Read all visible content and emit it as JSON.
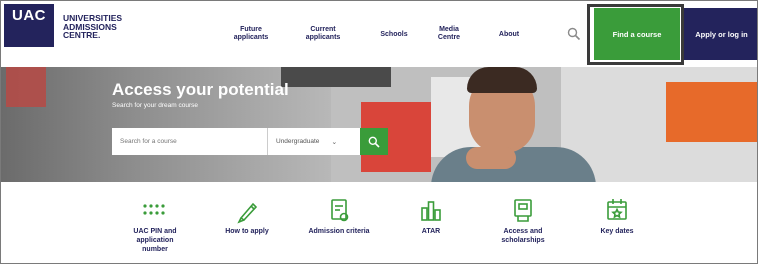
{
  "brand": {
    "logo_abbr": "UAC",
    "name_lines": [
      "UNIVERSITIES",
      "ADMISSIONS",
      "CENTRE."
    ]
  },
  "nav": {
    "items": [
      {
        "line1": "Future",
        "line2": "applicants"
      },
      {
        "line1": "Current",
        "line2": "applicants"
      },
      {
        "line1": "Schools",
        "line2": ""
      },
      {
        "line1": "Media",
        "line2": "Centre"
      },
      {
        "line1": "About",
        "line2": ""
      }
    ],
    "find_course": "Find a course",
    "apply_login": "Apply or log in"
  },
  "hero": {
    "title": "Access your potential",
    "subtitle": "Search for your dream course",
    "search_placeholder": "Search for a course",
    "level_selected": "Undergraduate"
  },
  "quick_links": [
    {
      "icon": "pin-dots-icon",
      "line1": "UAC PIN and",
      "line2": "application",
      "line3": "number"
    },
    {
      "icon": "pen-icon",
      "line1": "How to apply",
      "line2": "",
      "line3": ""
    },
    {
      "icon": "criteria-document-icon",
      "line1": "Admission criteria",
      "line2": "",
      "line3": ""
    },
    {
      "icon": "bar-chart-icon",
      "line1": "ATAR",
      "line2": "",
      "line3": ""
    },
    {
      "icon": "scholarship-icon",
      "line1": "Access and",
      "line2": "scholarships",
      "line3": ""
    },
    {
      "icon": "calendar-icon",
      "line1": "Key dates",
      "line2": "",
      "line3": ""
    }
  ],
  "colors": {
    "navy": "#23235c",
    "green": "#3a9c3a"
  }
}
